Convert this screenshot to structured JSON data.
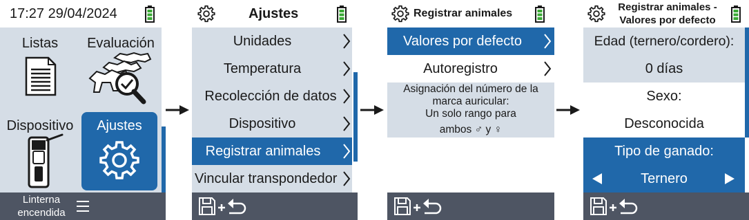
{
  "screen1": {
    "datetime": "17:27 29/04/2024",
    "tiles": [
      {
        "label": "Listas",
        "icon": "document-list-icon"
      },
      {
        "label": "Evaluación",
        "icon": "cattle-magnifier-icon"
      },
      {
        "label": "Dispositivo",
        "icon": "handheld-reader-icon"
      },
      {
        "label": "Ajustes",
        "icon": "gear-icon"
      }
    ],
    "footer": {
      "line1": "Linterna",
      "line2": "encendida"
    }
  },
  "screen2": {
    "title": "Ajustes",
    "items": [
      {
        "label": "Unidades"
      },
      {
        "label": "Temperatura"
      },
      {
        "label": "Recolección de datos"
      },
      {
        "label": "Dispositivo"
      },
      {
        "label": "Registrar animales",
        "selected": true
      },
      {
        "label": "Vincular transpondedor"
      }
    ]
  },
  "screen3": {
    "title": "Registrar animales",
    "items": [
      {
        "label": "Valores por defecto",
        "selected": true
      },
      {
        "label": "Autoregistro"
      }
    ],
    "info": {
      "line1": "Asignación del número de la",
      "line2": "marca auricular:",
      "line3": "Un solo rango para",
      "line4": "ambos ♂ y ♀"
    }
  },
  "screen4": {
    "title_line1": "Registrar animales -",
    "title_line2": "Valores por defecto",
    "age_label": "Edad (ternero/cordero):",
    "age_value": "0 días",
    "sex_label": "Sexo:",
    "sex_value": "Desconocida",
    "livestock_label": "Tipo de ganado:",
    "livestock_value": "Ternero"
  },
  "colors": {
    "accent": "#2068aa",
    "panel": "#d5dde6",
    "footer": "#4e5563",
    "battery": "#3aa935"
  }
}
